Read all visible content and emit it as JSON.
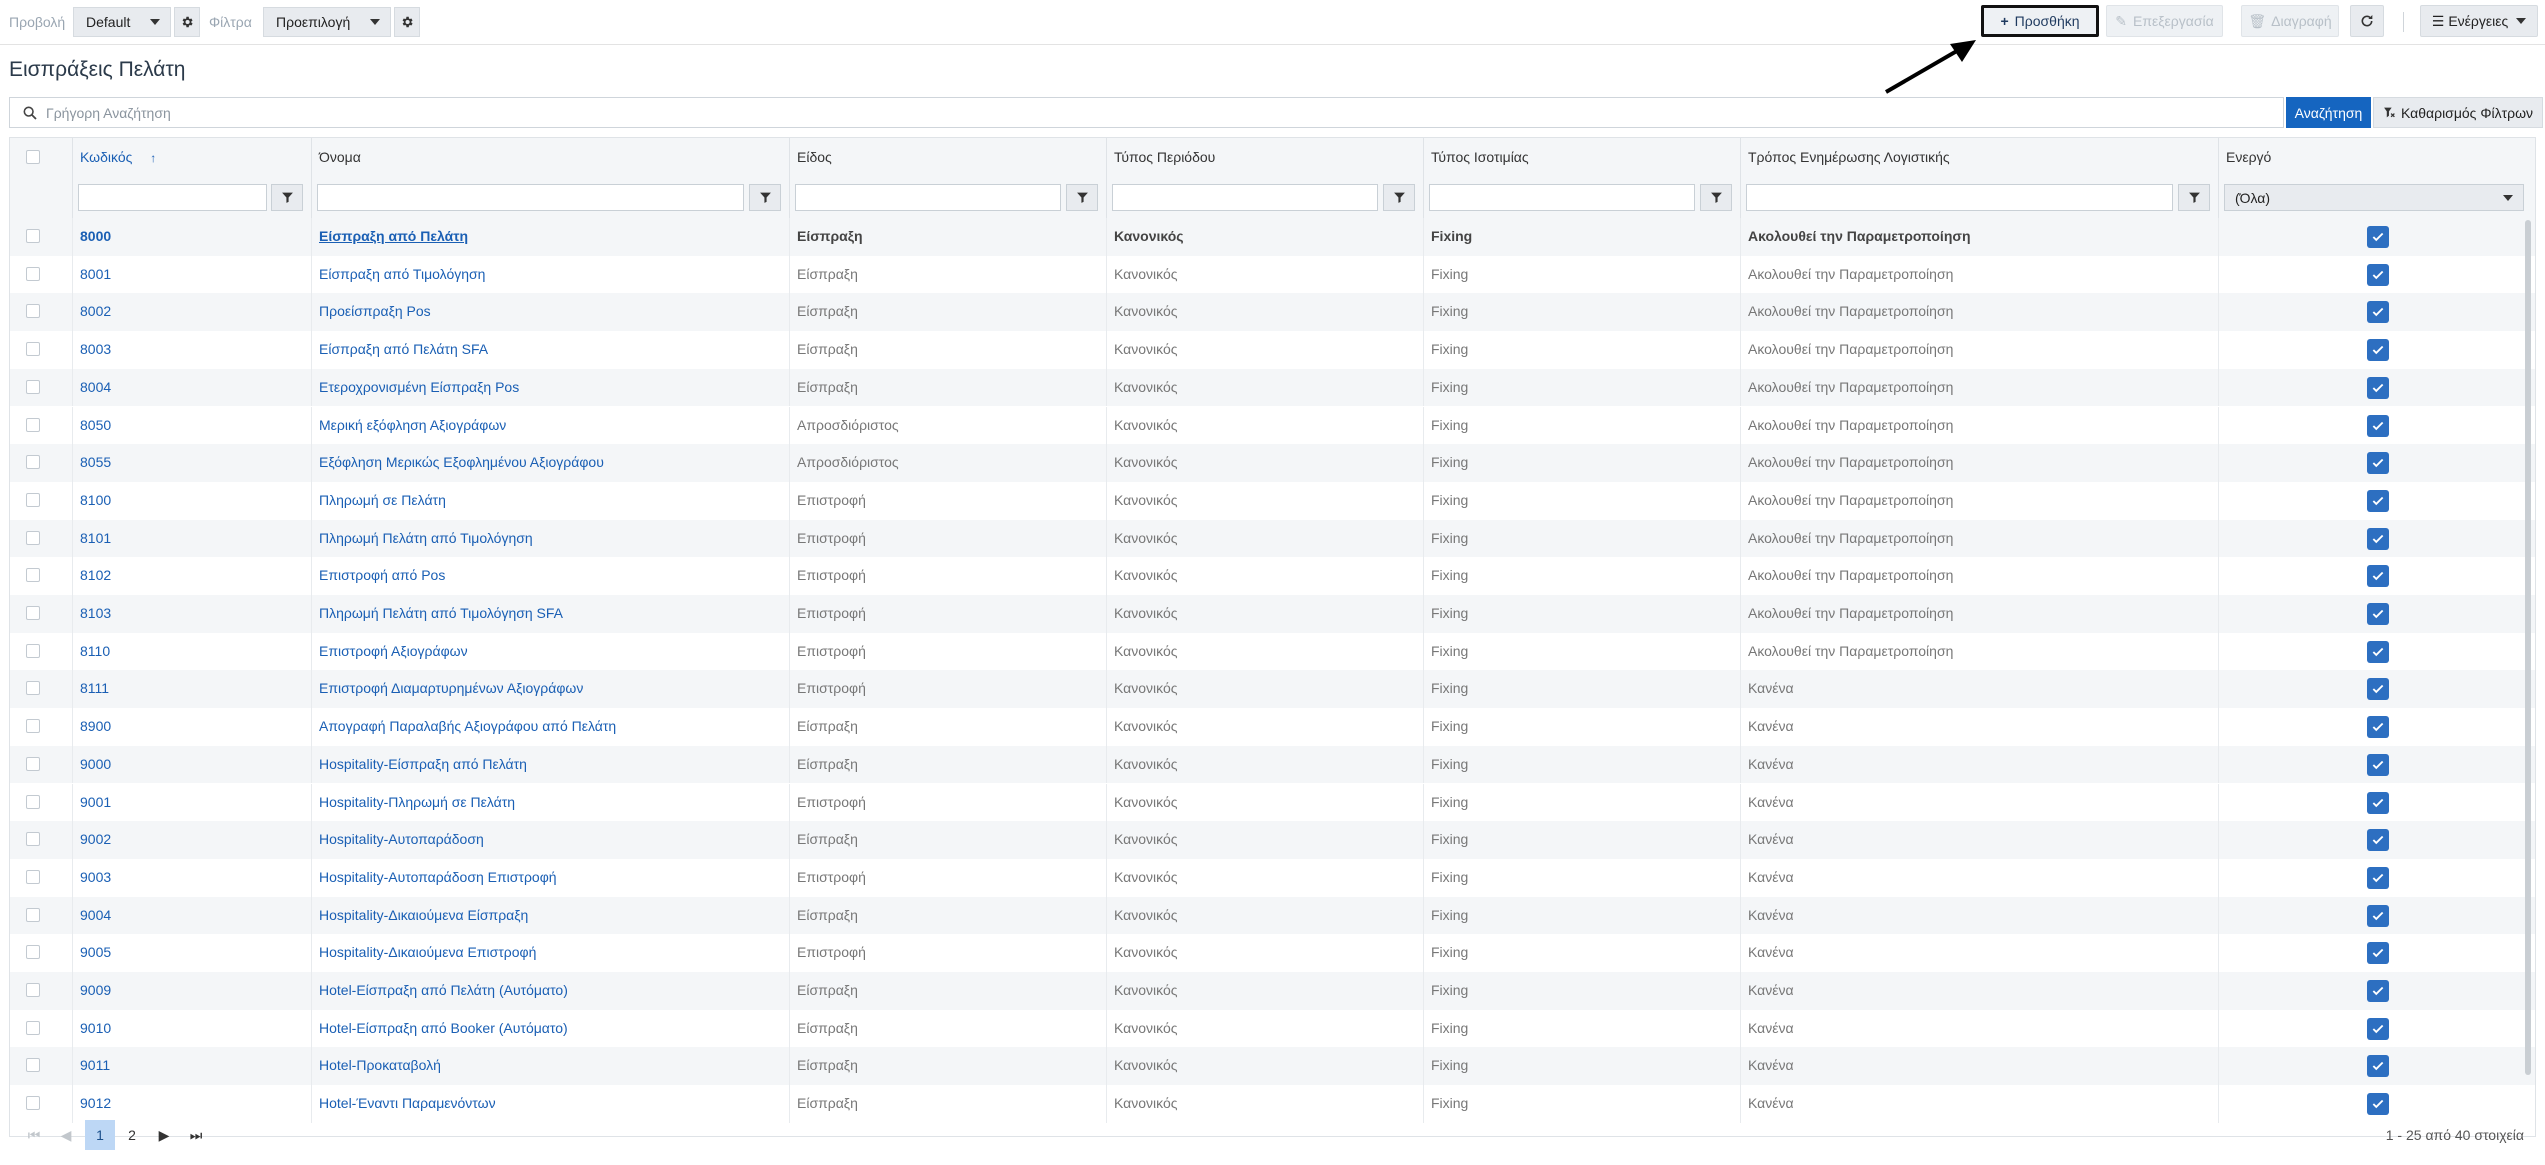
{
  "toolbar": {
    "view_label": "Προβολή",
    "view_value": "Default",
    "filters_label": "Φίλτρα",
    "filters_value": "Προεπιλογή",
    "add_label": "Προσθήκη",
    "edit_label": "Επεξεργασία",
    "delete_label": "Διαγραφή",
    "actions_label": "Ενέργειες"
  },
  "page": {
    "title": "Εισπράξεις Πελάτη"
  },
  "search": {
    "placeholder": "Γρήγορη Αναζήτηση",
    "search_button": "Αναζήτηση",
    "clear_button": "Καθαρισμός Φίλτρων"
  },
  "table": {
    "columns": [
      "Κωδικός",
      "Όνομα",
      "Είδος",
      "Τύπος Περιόδου",
      "Τύπος Ισοτιμίας",
      "Τρόπος Ενημέρωσης Λογιστικής",
      "Ενεργό"
    ],
    "sort_indicator": "↑",
    "active_filter_value": "(Όλα)",
    "rows": [
      {
        "code": "8000",
        "name": "Είσπραξη από Πελάτη",
        "kind": "Είσπραξη",
        "period": "Κανονικός",
        "rate": "Fixing",
        "accounting": "Ακολουθεί την Παραμετροποίηση",
        "active": true
      },
      {
        "code": "8001",
        "name": "Είσπραξη από Τιμολόγηση",
        "kind": "Είσπραξη",
        "period": "Κανονικός",
        "rate": "Fixing",
        "accounting": "Ακολουθεί την Παραμετροποίηση",
        "active": true
      },
      {
        "code": "8002",
        "name": "Προείσπραξη Pos",
        "kind": "Είσπραξη",
        "period": "Κανονικός",
        "rate": "Fixing",
        "accounting": "Ακολουθεί την Παραμετροποίηση",
        "active": true
      },
      {
        "code": "8003",
        "name": "Είσπραξη από Πελάτη SFA",
        "kind": "Είσπραξη",
        "period": "Κανονικός",
        "rate": "Fixing",
        "accounting": "Ακολουθεί την Παραμετροποίηση",
        "active": true
      },
      {
        "code": "8004",
        "name": "Ετεροχρονισμένη Είσπραξη Pos",
        "kind": "Είσπραξη",
        "period": "Κανονικός",
        "rate": "Fixing",
        "accounting": "Ακολουθεί την Παραμετροποίηση",
        "active": true
      },
      {
        "code": "8050",
        "name": "Μερική εξόφληση Αξιογράφων",
        "kind": "Απροσδιόριστος",
        "period": "Κανονικός",
        "rate": "Fixing",
        "accounting": "Ακολουθεί την Παραμετροποίηση",
        "active": true
      },
      {
        "code": "8055",
        "name": "Εξόφληση Μερικώς Εξοφλημένου Αξιογράφου",
        "kind": "Απροσδιόριστος",
        "period": "Κανονικός",
        "rate": "Fixing",
        "accounting": "Ακολουθεί την Παραμετροποίηση",
        "active": true
      },
      {
        "code": "8100",
        "name": "Πληρωμή σε Πελάτη",
        "kind": "Επιστροφή",
        "period": "Κανονικός",
        "rate": "Fixing",
        "accounting": "Ακολουθεί την Παραμετροποίηση",
        "active": true
      },
      {
        "code": "8101",
        "name": "Πληρωμή Πελάτη από Τιμολόγηση",
        "kind": "Επιστροφή",
        "period": "Κανονικός",
        "rate": "Fixing",
        "accounting": "Ακολουθεί την Παραμετροποίηση",
        "active": true
      },
      {
        "code": "8102",
        "name": "Επιστροφή από Pos",
        "kind": "Επιστροφή",
        "period": "Κανονικός",
        "rate": "Fixing",
        "accounting": "Ακολουθεί την Παραμετροποίηση",
        "active": true
      },
      {
        "code": "8103",
        "name": "Πληρωμή Πελάτη από Τιμολόγηση SFA",
        "kind": "Επιστροφή",
        "period": "Κανονικός",
        "rate": "Fixing",
        "accounting": "Ακολουθεί την Παραμετροποίηση",
        "active": true
      },
      {
        "code": "8110",
        "name": "Επιστροφή Αξιογράφων",
        "kind": "Επιστροφή",
        "period": "Κανονικός",
        "rate": "Fixing",
        "accounting": "Ακολουθεί την Παραμετροποίηση",
        "active": true
      },
      {
        "code": "8111",
        "name": "Επιστροφή Διαμαρτυρημένων Αξιογράφων",
        "kind": "Επιστροφή",
        "period": "Κανονικός",
        "rate": "Fixing",
        "accounting": "Κανένα",
        "active": true
      },
      {
        "code": "8900",
        "name": "Απογραφή Παραλαβής Αξιογράφου από Πελάτη",
        "kind": "Είσπραξη",
        "period": "Κανονικός",
        "rate": "Fixing",
        "accounting": "Κανένα",
        "active": true
      },
      {
        "code": "9000",
        "name": "Hospitality-Είσπραξη από Πελάτη",
        "kind": "Είσπραξη",
        "period": "Κανονικός",
        "rate": "Fixing",
        "accounting": "Κανένα",
        "active": true
      },
      {
        "code": "9001",
        "name": "Hospitality-Πληρωμή σε Πελάτη",
        "kind": "Επιστροφή",
        "period": "Κανονικός",
        "rate": "Fixing",
        "accounting": "Κανένα",
        "active": true
      },
      {
        "code": "9002",
        "name": "Hospitality-Αυτοπαράδοση",
        "kind": "Είσπραξη",
        "period": "Κανονικός",
        "rate": "Fixing",
        "accounting": "Κανένα",
        "active": true
      },
      {
        "code": "9003",
        "name": "Hospitality-Αυτοπαράδοση Επιστροφή",
        "kind": "Επιστροφή",
        "period": "Κανονικός",
        "rate": "Fixing",
        "accounting": "Κανένα",
        "active": true
      },
      {
        "code": "9004",
        "name": "Hospitality-Δικαιούμενα Είσπραξη",
        "kind": "Είσπραξη",
        "period": "Κανονικός",
        "rate": "Fixing",
        "accounting": "Κανένα",
        "active": true
      },
      {
        "code": "9005",
        "name": "Hospitality-Δικαιούμενα Επιστροφή",
        "kind": "Επιστροφή",
        "period": "Κανονικός",
        "rate": "Fixing",
        "accounting": "Κανένα",
        "active": true
      },
      {
        "code": "9009",
        "name": "Hotel-Είσπραξη από Πελάτη (Αυτόματο)",
        "kind": "Είσπραξη",
        "period": "Κανονικός",
        "rate": "Fixing",
        "accounting": "Κανένα",
        "active": true
      },
      {
        "code": "9010",
        "name": "Hotel-Είσπραξη από Booker (Αυτόματο)",
        "kind": "Είσπραξη",
        "period": "Κανονικός",
        "rate": "Fixing",
        "accounting": "Κανένα",
        "active": true
      },
      {
        "code": "9011",
        "name": "Hotel-Προκαταβολή",
        "kind": "Είσπραξη",
        "period": "Κανονικός",
        "rate": "Fixing",
        "accounting": "Κανένα",
        "active": true
      },
      {
        "code": "9012",
        "name": "Hotel-Έναντι Παραμενόντων",
        "kind": "Είσπραξη",
        "period": "Κανονικός",
        "rate": "Fixing",
        "accounting": "Κανένα",
        "active": true
      }
    ]
  },
  "pager": {
    "pages": [
      "1",
      "2"
    ],
    "current": "1",
    "info": "1 - 25 από 40 στοιχεία"
  },
  "colors": {
    "accent": "#1565c0",
    "link": "#1a5fb4",
    "checkbox": "#2d6fc1"
  }
}
